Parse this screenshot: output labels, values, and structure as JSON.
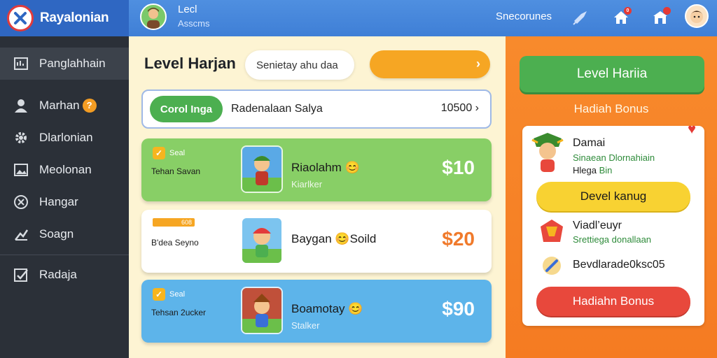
{
  "app": {
    "title": "Rayalonian"
  },
  "user": {
    "name": "Lecl",
    "subtitle": "Asscms"
  },
  "topbar": {
    "link": "Snecorunes",
    "notif_count": "0"
  },
  "sidebar": {
    "items": [
      {
        "label": "Panglahhain",
        "icon": "dashboard-icon"
      },
      {
        "label": "Marhan",
        "icon": "user-icon",
        "badge": "?"
      },
      {
        "label": "Dlarlonian",
        "icon": "gear-icon"
      },
      {
        "label": "Meolonan",
        "icon": "image-icon"
      },
      {
        "label": "Hangar",
        "icon": "close-circle-icon"
      },
      {
        "label": "Soagn",
        "icon": "chart-icon"
      },
      {
        "label": "Radaja",
        "icon": "check-box-icon"
      }
    ]
  },
  "main": {
    "title": "Level Harjan",
    "search_text": "Senietay ahu daa",
    "filter": {
      "pill": "Corol Inga",
      "label": "Radenalaan Salya",
      "amount": "10500"
    },
    "offers": [
      {
        "tag": "Seal",
        "subtitle": "Tehan Savan",
        "name": "Riaolahm",
        "meta": "Kiarlker",
        "price": "$10",
        "emoji": "😊"
      },
      {
        "tag": "608",
        "subtitle": "B'dea Seyno",
        "name": "Baygan",
        "name_extra": "Soild",
        "price": "$20",
        "emoji": "😊"
      },
      {
        "tag": "Seal",
        "subtitle": "Tehsan 2ucker",
        "name": "Boamotay",
        "meta": "Stalker",
        "price": "$90",
        "emoji": "😊"
      }
    ]
  },
  "panel": {
    "top_button": "Level Hariia",
    "heading": "Hadiah Bonus",
    "card": {
      "title": "Damai",
      "line1": "Sinaean Dlornahiain",
      "line2_dark": "Hlega",
      "line2_green": "Bin",
      "yellow_button": "Devel kanug",
      "row1_title": "Viadl’euyr",
      "row1_sub": "Srettiega donallaan",
      "row2_title": "Bevdlarade0ksc05",
      "red_button": "Hadiahn Bonus"
    }
  },
  "colors": {
    "accent": "#3f7fd6",
    "sidebar": "#2b3038",
    "panel": "#f57b22",
    "green": "#4caf50"
  }
}
